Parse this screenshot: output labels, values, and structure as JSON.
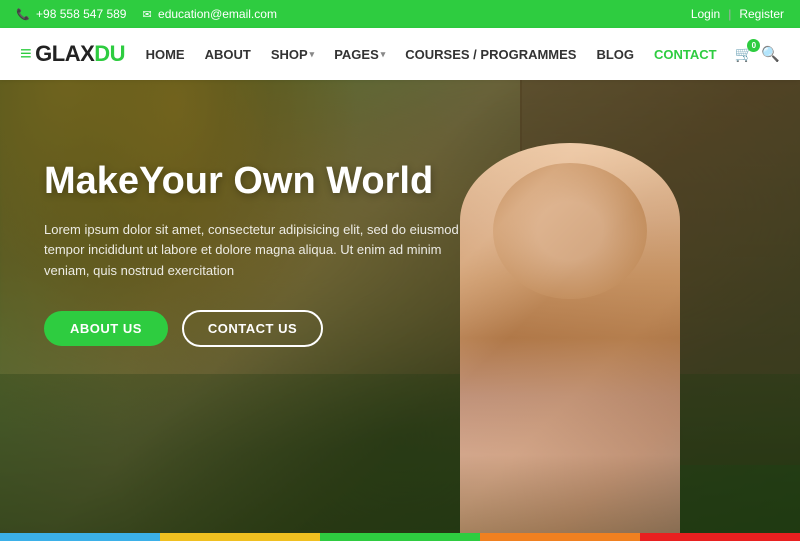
{
  "topbar": {
    "phone": "+98 558 547 589",
    "email": "education@email.com",
    "login": "Login",
    "divider": "|",
    "register": "Register"
  },
  "navbar": {
    "logo_text": "GLAX",
    "logo_highlight": "DU",
    "logo_icon": "≡",
    "links": [
      {
        "label": "HOME",
        "has_arrow": false
      },
      {
        "label": "ABOUT",
        "has_arrow": false
      },
      {
        "label": "SHOP",
        "has_arrow": true
      },
      {
        "label": "PAGES",
        "has_arrow": true
      },
      {
        "label": "COURSES / PROGRAMMES",
        "has_arrow": false
      },
      {
        "label": "BLOG",
        "has_arrow": false
      },
      {
        "label": "CONTACT",
        "has_arrow": false,
        "highlight": true
      }
    ],
    "cart_count": "0",
    "cart_icon": "🛒",
    "search_icon": "🔍"
  },
  "hero": {
    "title": "MakeYour Own World",
    "subtitle": "Lorem ipsum dolor sit amet, consectetur adipisicing elit, sed do eiusmod tempor incididunt ut labore et dolore magna aliqua. Ut enim ad minim veniam, quis nostrud exercitation",
    "btn_about": "ABOUT US",
    "btn_contact": "CONTACT US"
  },
  "bottom_strips": {
    "colors": [
      "#3bb0e8",
      "#f0c020",
      "#2ecc40",
      "#f08020",
      "#e82020"
    ]
  }
}
